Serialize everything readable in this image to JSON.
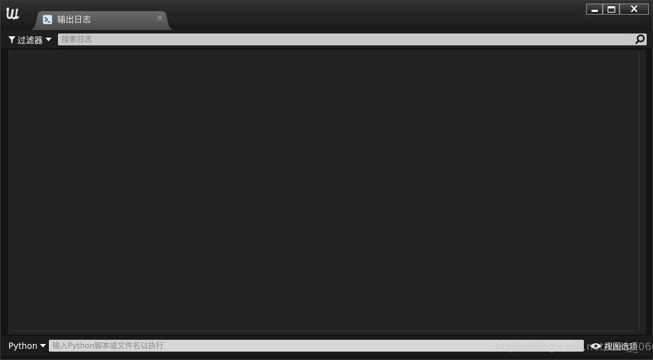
{
  "colors": {
    "window_bg": "#151515",
    "panel_bg": "#222222",
    "tab_bg": "#555555",
    "input_bg": "#c9c9c9",
    "text_light": "#ffffff"
  },
  "titlebar": {
    "logo_icon": "unreal-engine-logo-icon",
    "tab": {
      "icon": "terminal-icon",
      "label": "输出日志",
      "close_glyph": "×"
    },
    "controls": {
      "minimize_icon": "minimize-icon",
      "maximize_icon": "maximize-icon",
      "close_icon": "close-icon"
    }
  },
  "toolbar": {
    "filter_label": "过滤器",
    "search_placeholder": "搜索日志"
  },
  "log": {
    "lines": []
  },
  "cmdbar": {
    "interpreter_label": "Python",
    "input_placeholder": "输入Python脚本或文件名以执行",
    "view_options_label": "视图选项",
    "watermark": "https://blog.csdn.net/kang_066"
  }
}
